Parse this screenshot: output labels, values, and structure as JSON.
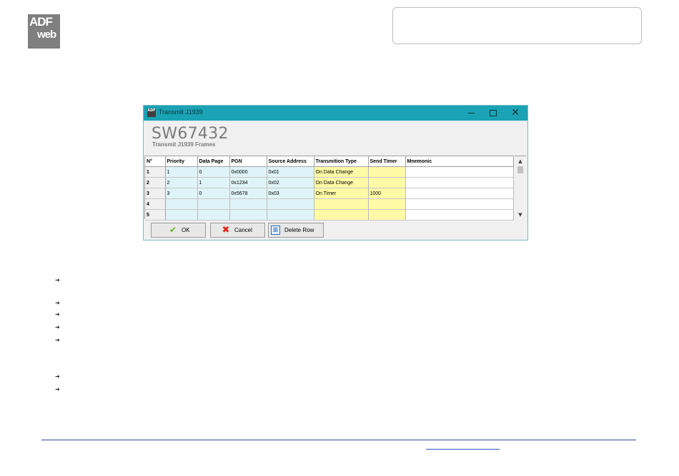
{
  "logo": {
    "line1": "ADF",
    "line2": "web"
  },
  "window": {
    "title": "Transmit J1939",
    "app_icon": "ADF",
    "heading": "SW67432",
    "subheading": "Transmit J1939 Frames",
    "controls": {
      "minimize": "minimize-icon",
      "maximize": "maximize-icon",
      "close": "✕"
    }
  },
  "grid": {
    "columns": [
      "N°",
      "Priority",
      "Data Page",
      "PGN",
      "Source Address",
      "Transmition Type",
      "Send Timer",
      "Mnemonic"
    ],
    "rows": [
      {
        "num": "1",
        "priority": "1",
        "data_page": "0",
        "pgn": "0x0000",
        "source": "0x01",
        "type": "On Data Change",
        "timer": "",
        "mnemonic": ""
      },
      {
        "num": "2",
        "priority": "2",
        "data_page": "1",
        "pgn": "0x1234",
        "source": "0x02",
        "type": "On Data Change",
        "timer": "",
        "mnemonic": ""
      },
      {
        "num": "3",
        "priority": "3",
        "data_page": "0",
        "pgn": "0x5678",
        "source": "0x03",
        "type": "On Timer",
        "timer": "1000",
        "mnemonic": ""
      },
      {
        "num": "4",
        "priority": "",
        "data_page": "",
        "pgn": "",
        "source": "",
        "type": "",
        "timer": "",
        "mnemonic": ""
      },
      {
        "num": "5",
        "priority": "",
        "data_page": "",
        "pgn": "",
        "source": "",
        "type": "",
        "timer": "",
        "mnemonic": ""
      }
    ],
    "scroll_up": "▲",
    "scroll_down": "▼"
  },
  "buttons": {
    "ok": {
      "label": "OK",
      "icon": "✔"
    },
    "cancel": {
      "label": "Cancel",
      "icon": "✖"
    },
    "delete": {
      "label": "Delete Row",
      "icon": "≡"
    }
  },
  "bullet_glyph": "➜",
  "colors": {
    "titlebar": "#1aa3b5",
    "cyan_cell": "#dff4f9",
    "yellow_cell": "#fffaa6",
    "footer_line": "#2e4a9a"
  }
}
